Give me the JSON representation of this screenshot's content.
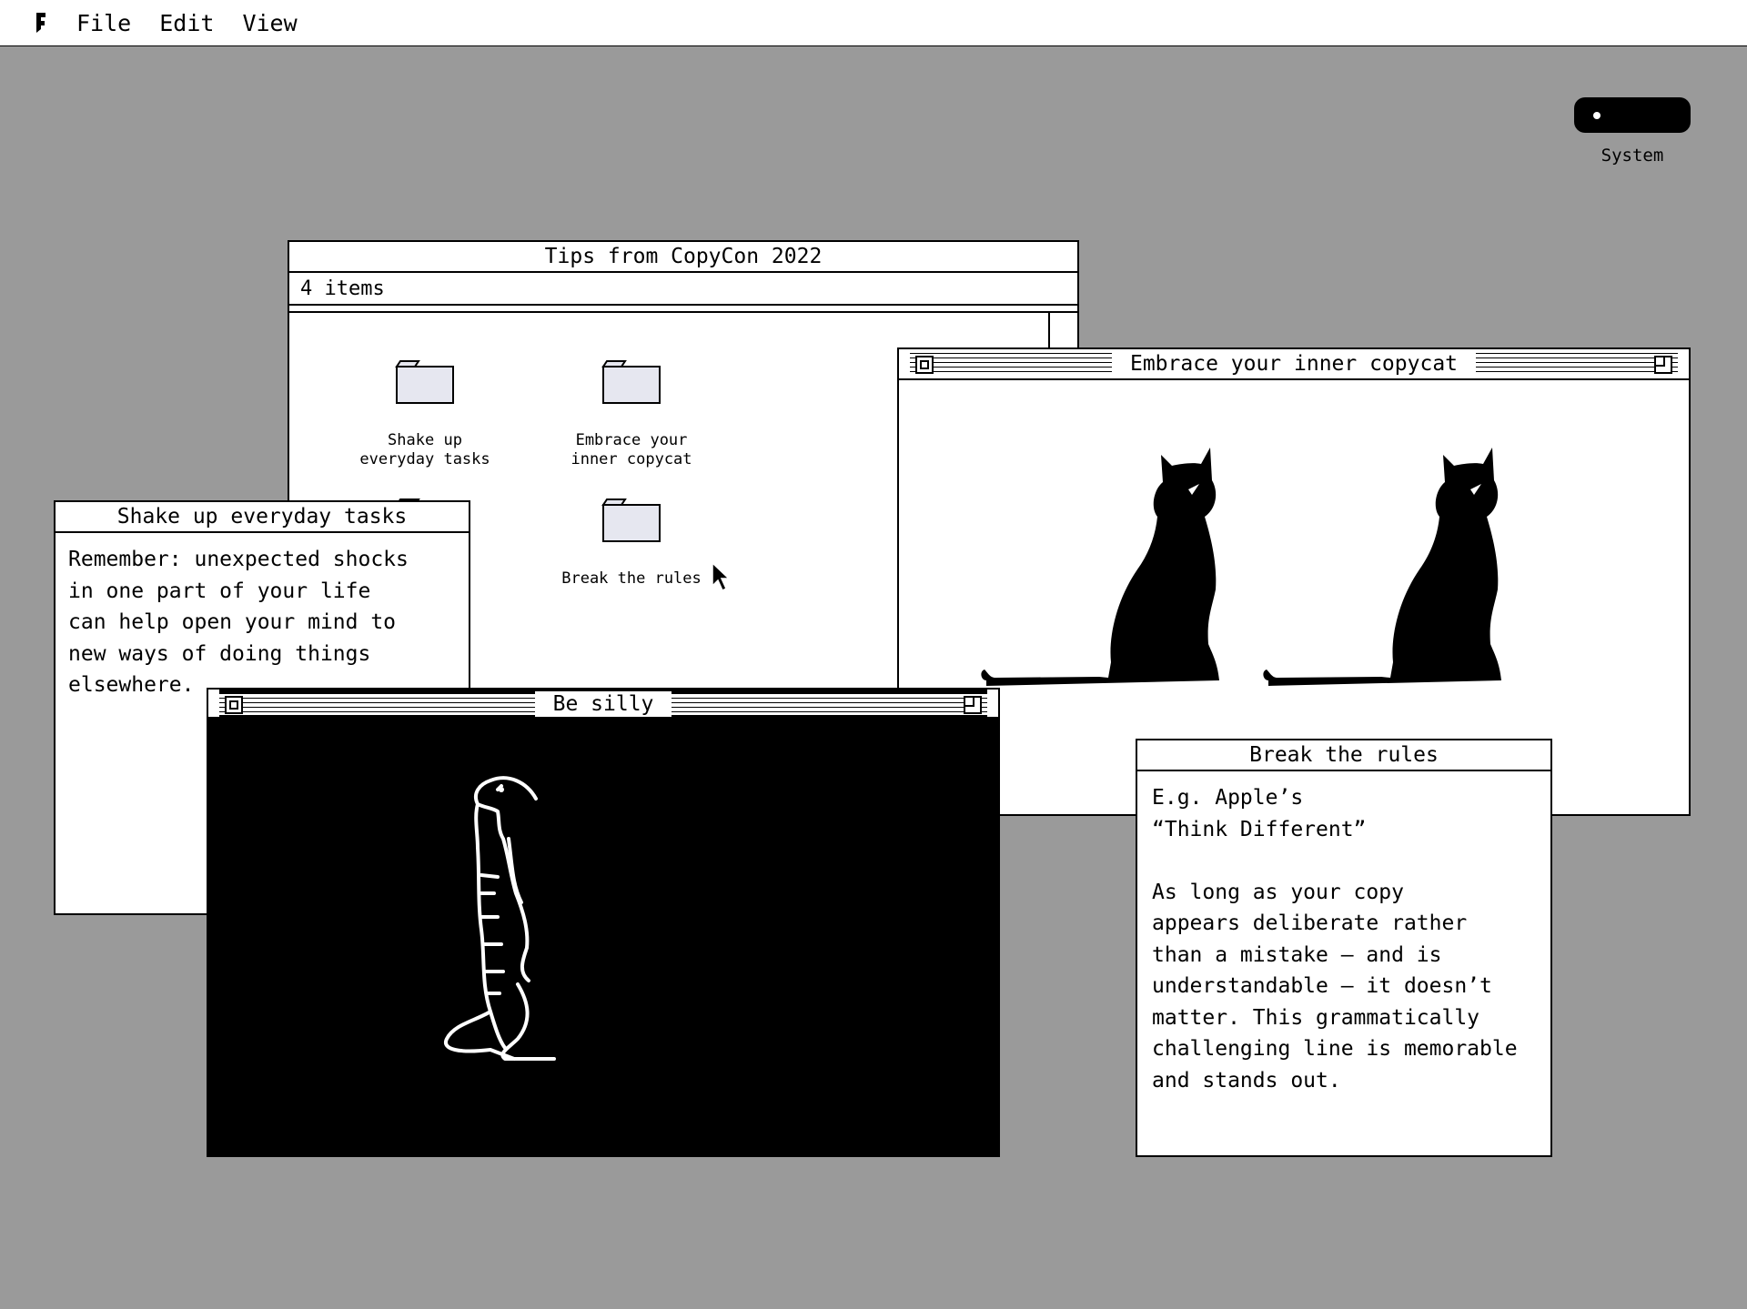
{
  "menubar": {
    "logo_icon": "app-logo-icon",
    "items": [
      "File",
      "Edit",
      "View"
    ]
  },
  "system": {
    "label": "System"
  },
  "tips_window": {
    "title": "Tips from CopyCon 2022",
    "item_count": "4 items",
    "folders": [
      {
        "label": "Shake up\neveryday tasks"
      },
      {
        "label": "Embrace your\ninner copycat"
      },
      {
        "label": ""
      },
      {
        "label": "Break the rules"
      }
    ]
  },
  "shake_window": {
    "title": "Shake up everyday tasks",
    "text": "Remember: unexpected shocks\nin one part of your life\ncan help open your mind to\nnew ways of doing things\nelsewhere."
  },
  "copycat_window": {
    "title": "Embrace your inner copycat"
  },
  "silly_window": {
    "title": "Be silly"
  },
  "rules_window": {
    "title": "Break the rules",
    "text": "E.g. Apple’s\n“Think Different”\n\nAs long as your copy\nappears deliberate rather\nthan a mistake – and is\nunderstandable – it doesn’t\nmatter. This grammatically\nchallenging line is memorable\nand stands out."
  }
}
